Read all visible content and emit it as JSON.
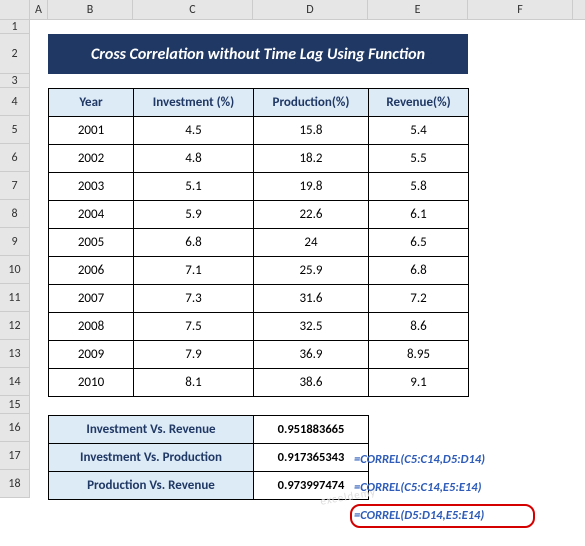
{
  "columns": [
    "A",
    "B",
    "C",
    "D",
    "E",
    "F"
  ],
  "rows": [
    "1",
    "2",
    "3",
    "4",
    "5",
    "6",
    "7",
    "8",
    "9",
    "10",
    "11",
    "12",
    "13",
    "14",
    "15",
    "16",
    "17",
    "18"
  ],
  "title": "Cross Correlation without Time Lag Using Function",
  "headers": {
    "B": "Year",
    "C": "Investment (%)",
    "D": "Production(%)",
    "E": "Revenue(%)"
  },
  "data": [
    {
      "year": "2001",
      "inv": "4.5",
      "prod": "15.8",
      "rev": "5.4"
    },
    {
      "year": "2002",
      "inv": "4.8",
      "prod": "18.2",
      "rev": "5.5"
    },
    {
      "year": "2003",
      "inv": "5.1",
      "prod": "19.8",
      "rev": "5.8"
    },
    {
      "year": "2004",
      "inv": "5.9",
      "prod": "22.6",
      "rev": "6.1"
    },
    {
      "year": "2005",
      "inv": "6.8",
      "prod": "24",
      "rev": "6.5"
    },
    {
      "year": "2006",
      "inv": "7.1",
      "prod": "25.9",
      "rev": "6.8"
    },
    {
      "year": "2007",
      "inv": "7.3",
      "prod": "31.6",
      "rev": "7.2"
    },
    {
      "year": "2008",
      "inv": "7.5",
      "prod": "32.5",
      "rev": "8.6"
    },
    {
      "year": "2009",
      "inv": "7.9",
      "prod": "36.9",
      "rev": "8.95"
    },
    {
      "year": "2010",
      "inv": "8.1",
      "prod": "38.6",
      "rev": "9.1"
    }
  ],
  "corr": [
    {
      "label": "Investment Vs. Revenue",
      "val": "0.951883665",
      "formula": "=CORREL(C5:C14,D5:D14)"
    },
    {
      "label": "Investment Vs. Production",
      "val": "0.917365343",
      "formula": "=CORREL(C5:C14,E5:E14)"
    },
    {
      "label": "Production Vs. Revenue",
      "val": "0.973997474",
      "formula": "=CORREL(D5:D14,E5:E14)"
    }
  ],
  "watermark": "exceldemy"
}
